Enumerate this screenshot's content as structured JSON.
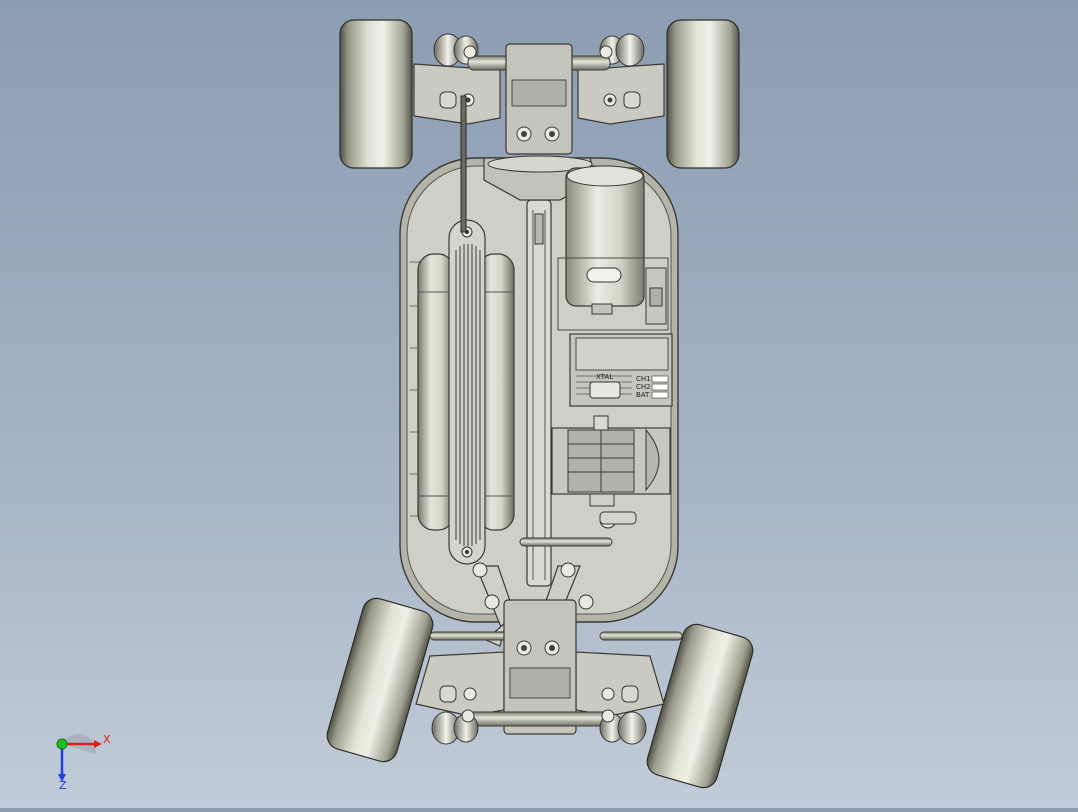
{
  "scene": {
    "model_name": "rc-car-chassis-top-view",
    "background_top": "#8c9db2",
    "background_bottom": "#c2ccd8"
  },
  "parts": {
    "esc_brand": "XTAL",
    "channel_labels": [
      "CH1",
      "CH2",
      "BAT"
    ]
  },
  "triad": {
    "x_label": "X",
    "z_label": "Z",
    "x_color": "#e02020",
    "y_color": "#20c020",
    "z_color": "#2040e0"
  }
}
